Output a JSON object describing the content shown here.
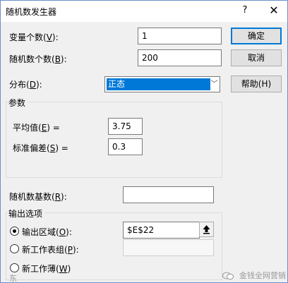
{
  "window": {
    "title": "随机数发生器",
    "help_glyph": "?",
    "close_glyph": "✕"
  },
  "fields": {
    "var_count": {
      "label_pre": "变量个数(",
      "hotkey": "V",
      "label_post": "):",
      "value": "1"
    },
    "rand_count": {
      "label_pre": "随机数个数(",
      "hotkey": "B",
      "label_post": "):",
      "value": "200"
    },
    "distribution": {
      "label_pre": "分布(",
      "hotkey": "D",
      "label_post": "):",
      "value": "正态"
    }
  },
  "buttons": {
    "ok": "确定",
    "cancel": "取消",
    "help": "帮助(H)"
  },
  "params": {
    "title": "参数",
    "mean": {
      "label_pre": "平均值(",
      "hotkey": "E",
      "label_post": ") =",
      "value": "3.75"
    },
    "stdev": {
      "label_pre": "标准偏差(",
      "hotkey": "S",
      "label_post": ") =",
      "value": "0.3"
    }
  },
  "seed": {
    "label_pre": "随机数基数(",
    "hotkey": "R",
    "label_post": "):",
    "value": ""
  },
  "output": {
    "title": "输出选项",
    "range": {
      "label_pre": "输出区域(",
      "hotkey": "O",
      "label_post": "):",
      "value": "$E$22",
      "selected": true
    },
    "new_sheet": {
      "label_pre": "新工作表组(",
      "hotkey": "P",
      "label_post": "):",
      "value": "",
      "selected": false
    },
    "new_book": {
      "label_pre": "新工作薄(",
      "hotkey": "W",
      "label_post": ")",
      "selected": false
    }
  },
  "watermark": {
    "left": "东",
    "right": "金钱全网营销"
  }
}
